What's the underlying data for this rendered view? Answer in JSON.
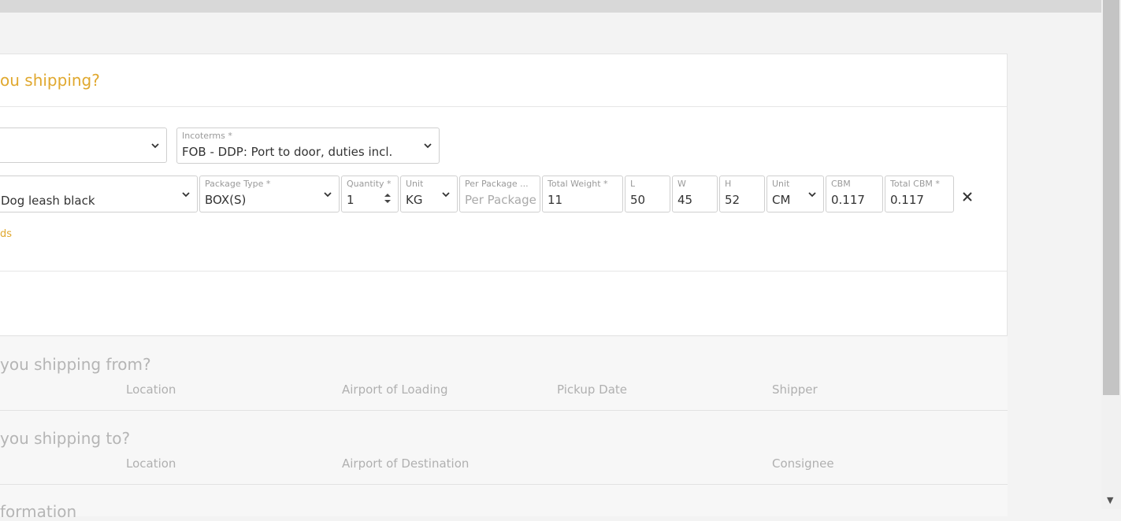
{
  "colors": {
    "accent": "#e0a82e",
    "muted": "#b0b0b0",
    "border": "#cfcfcf"
  },
  "cargo": {
    "title": "ou shipping?",
    "incoterms": {
      "label": "Incoterms *",
      "value": "FOB - DDP: Port to door, duties incl."
    },
    "item": {
      "product": "Dog leash black",
      "package_type": {
        "label": "Package Type *",
        "value": "BOX(S)"
      },
      "quantity": {
        "label": "Quantity *",
        "value": "1"
      },
      "weight_unit": {
        "label": "Unit",
        "value": "KG"
      },
      "per_package": {
        "label": "Per Package ...",
        "placeholder": "Per Package"
      },
      "total_weight": {
        "label": "Total Weight *",
        "value": "11"
      },
      "length": {
        "label": "L",
        "value": "50"
      },
      "width": {
        "label": "W",
        "value": "45"
      },
      "height": {
        "label": "H",
        "value": "52"
      },
      "dim_unit": {
        "label": "Unit",
        "value": "CM"
      },
      "cbm": {
        "label": "CBM",
        "value": "0.117"
      },
      "total_cbm": {
        "label": "Total CBM *",
        "value": "0.117"
      }
    },
    "link_fragment": "ds"
  },
  "from_section": {
    "title": "you shipping from?",
    "columns": [
      "Location",
      "Airport of Loading",
      "Pickup Date",
      "Shipper"
    ]
  },
  "to_section": {
    "title": "you shipping to?",
    "columns": [
      "Location",
      "Airport of Destination",
      "Consignee"
    ]
  },
  "info_section": {
    "title": "formation"
  }
}
